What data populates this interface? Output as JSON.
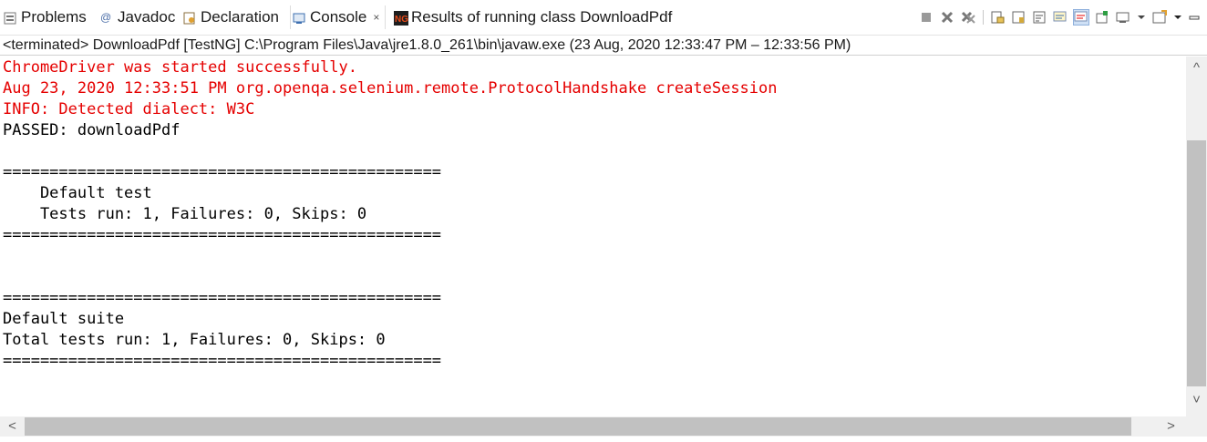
{
  "tabs": [
    {
      "label": "Problems"
    },
    {
      "label": "Javadoc"
    },
    {
      "label": "Declaration"
    },
    {
      "label": "Console",
      "close": "×"
    },
    {
      "label": "Results of running class DownloadPdf"
    }
  ],
  "status": {
    "text": "<terminated> DownloadPdf [TestNG] C:\\Program Files\\Java\\jre1.8.0_261\\bin\\javaw.exe  (23 Aug, 2020 12:33:47 PM – 12:33:56 PM)"
  },
  "console": {
    "lines": [
      {
        "text": "ChromeDriver was started successfully.",
        "stream": "err"
      },
      {
        "text": "Aug 23, 2020 12:33:51 PM org.openqa.selenium.remote.ProtocolHandshake createSession",
        "stream": "err"
      },
      {
        "text": "INFO: Detected dialect: W3C",
        "stream": "err"
      },
      {
        "text": "PASSED: downloadPdf",
        "stream": "out"
      },
      {
        "text": "",
        "stream": "out"
      },
      {
        "text": "===============================================",
        "stream": "out"
      },
      {
        "text": "    Default test",
        "stream": "out"
      },
      {
        "text": "    Tests run: 1, Failures: 0, Skips: 0",
        "stream": "out"
      },
      {
        "text": "===============================================",
        "stream": "out"
      },
      {
        "text": "",
        "stream": "out"
      },
      {
        "text": "",
        "stream": "out"
      },
      {
        "text": "===============================================",
        "stream": "out"
      },
      {
        "text": "Default suite",
        "stream": "out"
      },
      {
        "text": "Total tests run: 1, Failures: 0, Skips: 0",
        "stream": "out"
      },
      {
        "text": "===============================================",
        "stream": "out"
      }
    ]
  },
  "scrollbars": {
    "up": "^",
    "down": "˅",
    "left": "<",
    "right": ">"
  },
  "icons": {
    "problems": "problems-icon",
    "javadoc": "javadoc-icon",
    "declaration": "declaration-icon",
    "console": "console-icon",
    "testng": "testng-icon"
  },
  "colors": {
    "stderr": "#e50000",
    "stdout": "#000000"
  }
}
